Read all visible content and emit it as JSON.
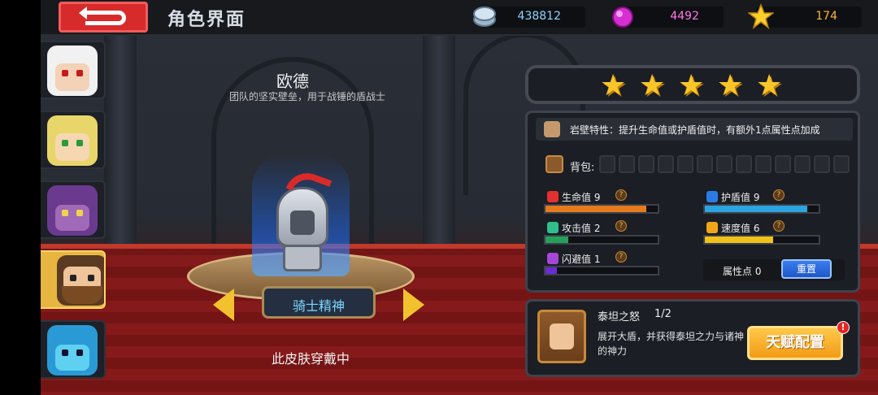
{
  "header": {
    "title": "角色界面",
    "resources": [
      {
        "icon": "silver-coin-icon",
        "value": "438812"
      },
      {
        "icon": "gem-icon",
        "value": "4492"
      },
      {
        "icon": "star-icon",
        "value": "174"
      }
    ]
  },
  "heroes": [
    {
      "name": "white-haired-hero",
      "selected": false
    },
    {
      "name": "green-elf-hero",
      "selected": false
    },
    {
      "name": "purple-cat-hero",
      "selected": false
    },
    {
      "name": "bearded-warrior-hero",
      "selected": true
    },
    {
      "name": "blue-dragon-hero",
      "selected": false
    }
  ],
  "hero": {
    "name": "欧德",
    "description": "团队的坚实壁垒，用于战锤的盾战士",
    "stars": 5
  },
  "skin": {
    "name": "骑士精神",
    "status": "此皮肤穿戴中"
  },
  "trait": {
    "text": "岩壁特性：提升生命值或护盾值时，有额外1点属性点加成"
  },
  "bag": {
    "label": "背包:",
    "slots": 13
  },
  "stats": [
    {
      "key": "hp",
      "label": "生命值 9",
      "fill": 0.9,
      "color": "#e57b1c",
      "icon_color": "#e53030"
    },
    {
      "key": "shield",
      "label": "护盾值 9",
      "fill": 0.9,
      "color": "#2ba4df",
      "icon_color": "#2b7be5"
    },
    {
      "key": "attack",
      "label": "攻击值 2",
      "fill": 0.2,
      "color": "#23a15a",
      "icon_color": "#2fbf8a"
    },
    {
      "key": "speed",
      "label": "速度值 6",
      "fill": 0.6,
      "color": "#f0c21a",
      "icon_color": "#f0a61a"
    },
    {
      "key": "dodge",
      "label": "闪避值 1",
      "fill": 0.1,
      "color": "#6a2bd6",
      "icon_color": "#a546d9"
    }
  ],
  "attributes": {
    "label": "属性点 0",
    "reset_label": "重置"
  },
  "talent": {
    "name": "泰坦之怒",
    "level": "1/2",
    "description": "展开大盾，并获得泰坦之力与诸神的神力",
    "button_label": "天赋配置",
    "alert": "!"
  }
}
